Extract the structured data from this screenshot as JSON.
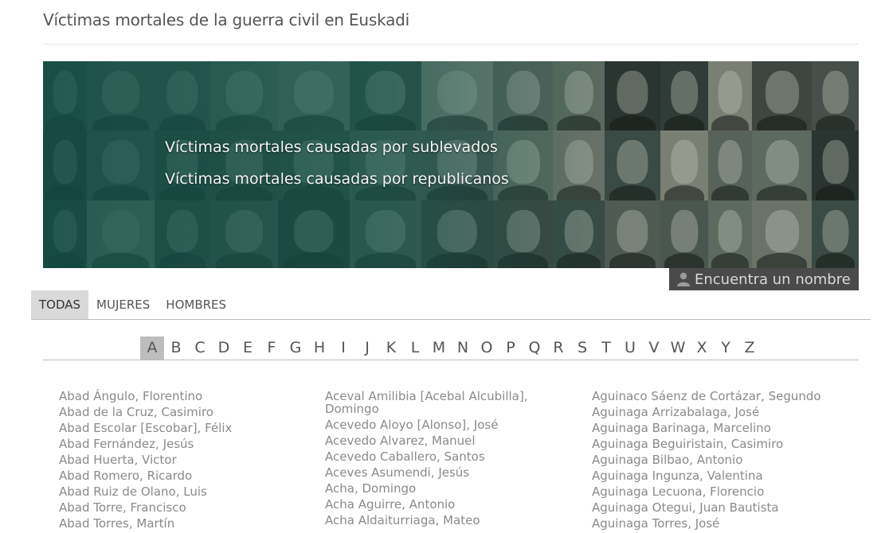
{
  "site": {
    "title": "Víctimas mortales de la guerra civil en Euskadi"
  },
  "banner": {
    "links": [
      "Víctimas mortales causadas por sublevados",
      "Víctimas mortales causadas por republicanos"
    ],
    "find_button": {
      "icon": "person-icon",
      "label": "Encuentra un nombre"
    }
  },
  "tabs": [
    {
      "label": "TODAS",
      "active": true
    },
    {
      "label": "MUJERES",
      "active": false
    },
    {
      "label": "HOMBRES",
      "active": false
    }
  ],
  "alphabet": {
    "active": "A",
    "letters": [
      "A",
      "B",
      "C",
      "D",
      "E",
      "F",
      "G",
      "H",
      "I",
      "J",
      "K",
      "L",
      "M",
      "N",
      "O",
      "P",
      "Q",
      "R",
      "S",
      "T",
      "U",
      "V",
      "W",
      "X",
      "Y",
      "Z"
    ]
  },
  "names": {
    "col1": [
      "Abad Ángulo, Florentino",
      "Abad de la Cruz, Casimiro",
      "Abad Escolar [Escobar], Félix",
      "Abad Fernández, Jesús",
      "Abad Huerta, Victor",
      "Abad Romero, Ricardo",
      "Abad Ruiz de Olano, Luis",
      "Abad Torre, Francisco",
      "Abad Torres, Martín"
    ],
    "col2": [
      "Aceval Amilibia [Acebal Alcubilla], Domingo",
      "Acevedo Aloyo [Alonso], José",
      "Acevedo Alvarez, Manuel",
      "Acevedo Caballero, Santos",
      "Aceves Asumendi, Jesús",
      "Acha, Domingo",
      "Acha Aguirre, Antonio",
      "Acha Aldaiturriaga, Mateo"
    ],
    "col3": [
      "Aguinaco Sáenz de Cortázar, Segundo",
      "Aguinaga Arrizabalaga, José",
      "Aguinaga Barinaga, Marcelino",
      "Aguinaga Beguiristain, Casimiro",
      "Aguinaga Bilbao, Antonio",
      "Aguinaga Ingunza, Valentina",
      "Aguinaga Lecuona, Florencio",
      "Aguinaga Otegui, Juan Bautista",
      "Aguinaga Torres, José"
    ]
  }
}
